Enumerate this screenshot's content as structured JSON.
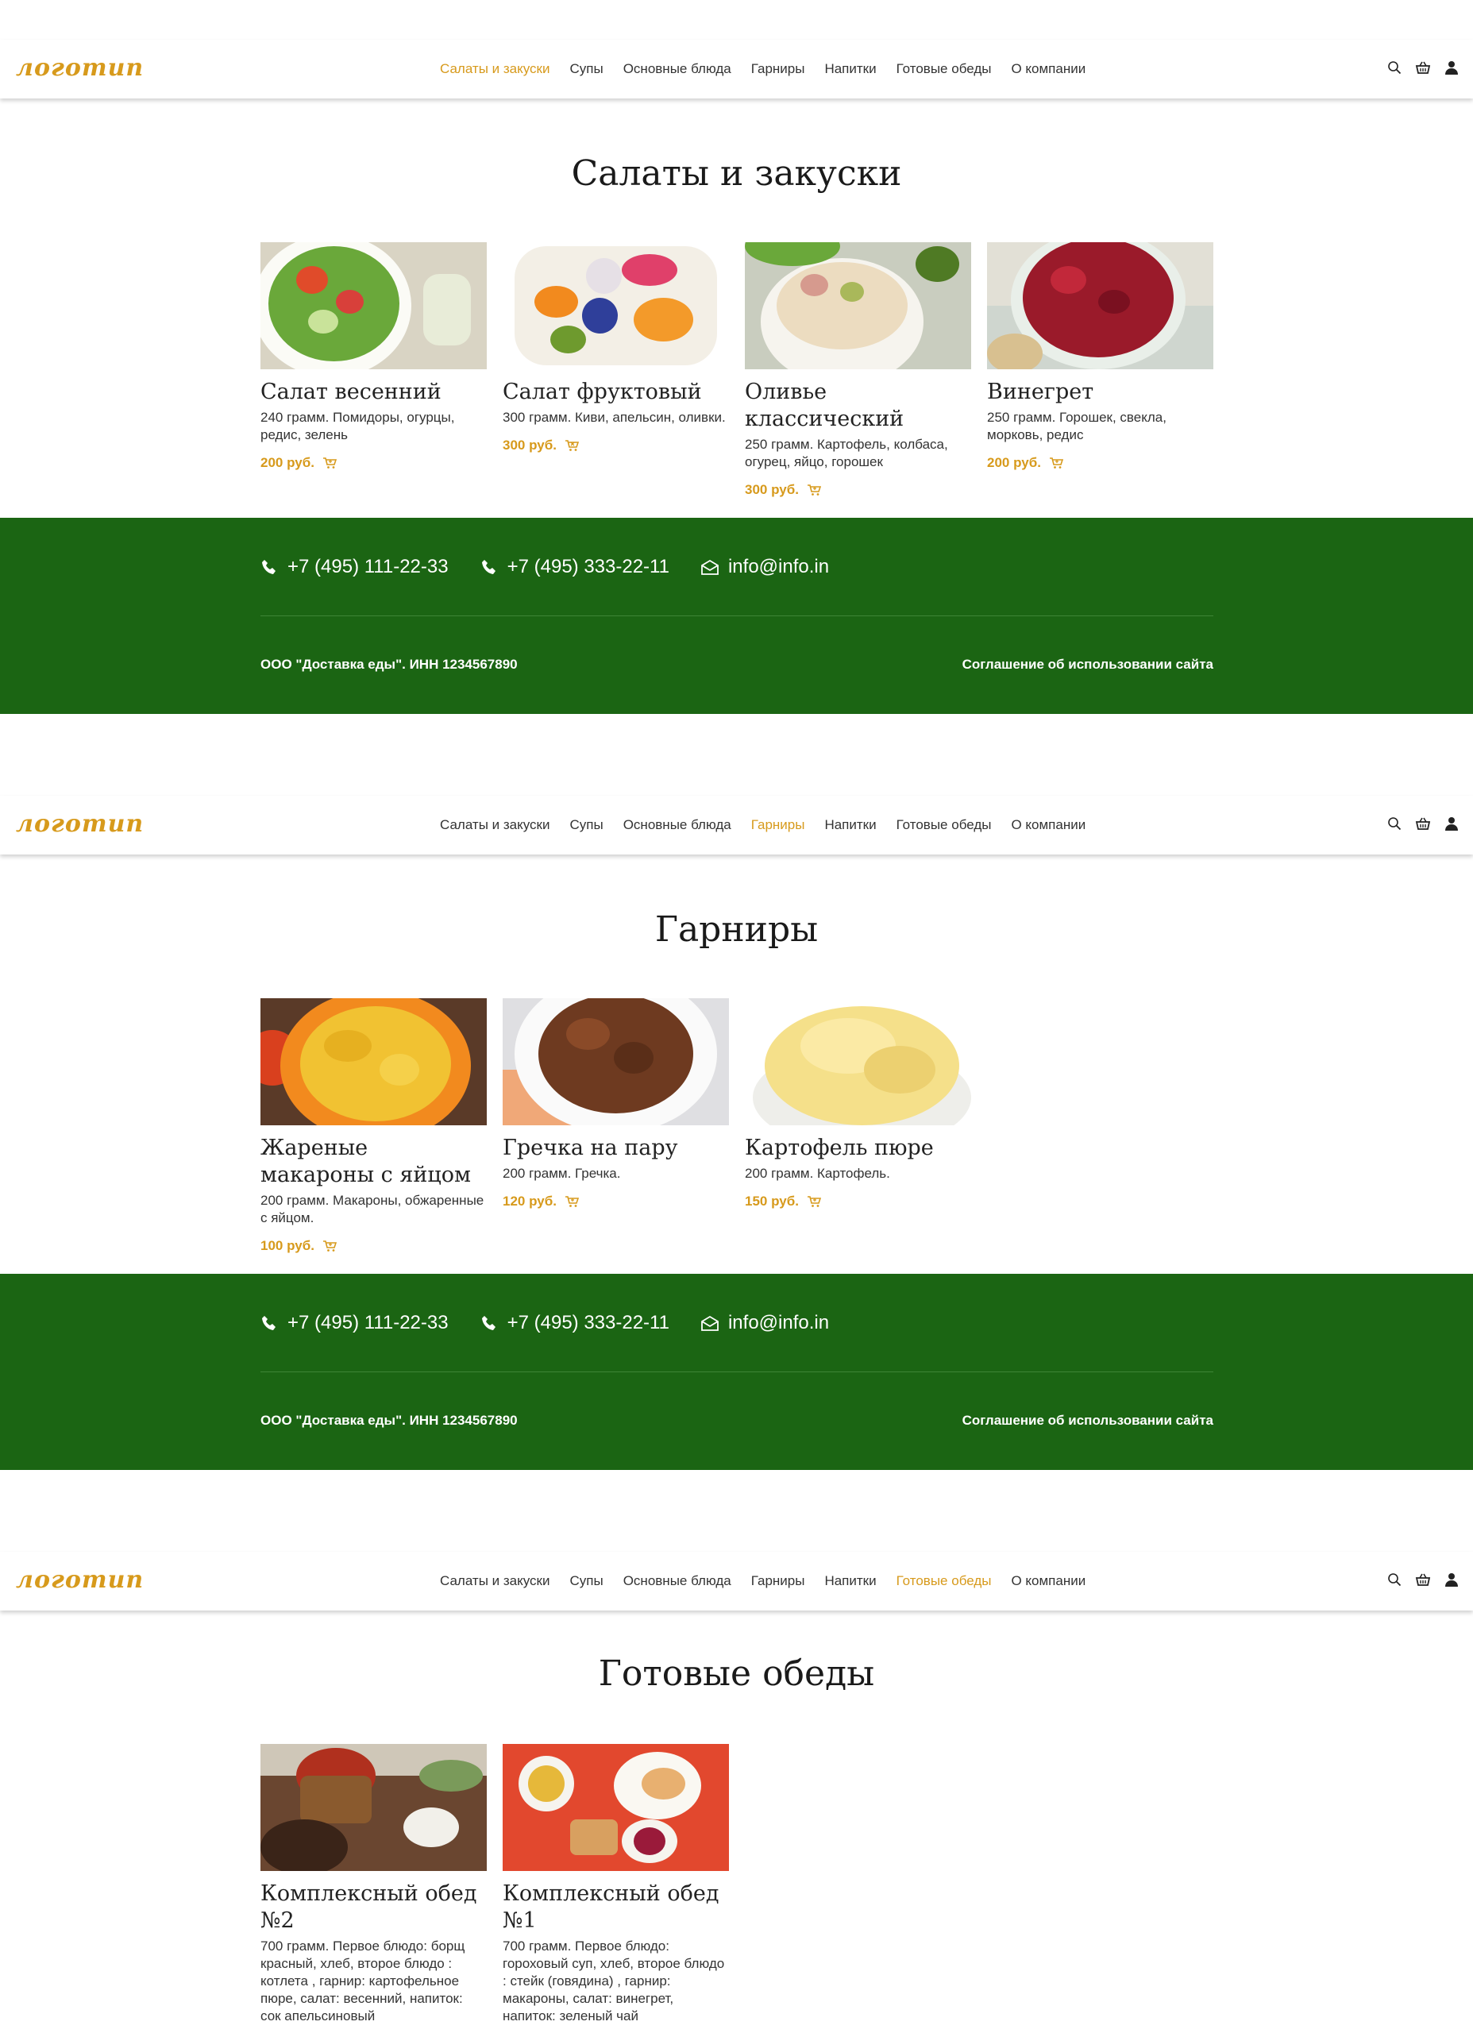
{
  "brand": {
    "logo_text": "логотип",
    "accent": "#d79a1c",
    "footer_bg": "#1b6513"
  },
  "nav": [
    "Салаты и закуски",
    "Супы",
    "Основные блюда",
    "Гарниры",
    "Напитки",
    "Готовые обеды",
    "О компании"
  ],
  "header_icons": [
    "search-icon",
    "basket-icon",
    "user-icon"
  ],
  "footer": {
    "phone1": "+7 (495) 111-22-33",
    "phone2": "+7 (495) 333-22-11",
    "email": "info@info.in",
    "company": "ООО \"Доставка еды\". ИНН 1234567890",
    "terms": "Соглашение об использовании сайта"
  },
  "pages": [
    {
      "title": "Салаты и закуски",
      "active_nav": 0,
      "cards": [
        {
          "name": "Салат весенний",
          "desc": "240 грамм. Помидоры, огурцы, редис, зелень",
          "price": "200 руб."
        },
        {
          "name": "Салат фруктовый",
          "desc": "300 грамм. Киви, апельсин, оливки.",
          "price": "300 руб."
        },
        {
          "name": "Оливье классический",
          "desc": "250 грамм. Картофель, колбаса, огурец, яйцо, горошек",
          "price": "300 руб."
        },
        {
          "name": "Винегрет",
          "desc": "250 грамм. Горошек, свекла, морковь, редис",
          "price": "200 руб."
        }
      ]
    },
    {
      "title": "Гарниры",
      "active_nav": 3,
      "cards": [
        {
          "name": "Жареные макароны с яйцом",
          "desc": "200 грамм. Макароны, обжаренные с яйцом.",
          "price": "100 руб."
        },
        {
          "name": "Гречка на пару",
          "desc": "200 грамм. Гречка.",
          "price": "120 руб."
        },
        {
          "name": "Картофель пюре",
          "desc": "200 грамм. Картофель.",
          "price": "150 руб."
        }
      ]
    },
    {
      "title": "Готовые обеды",
      "active_nav": 5,
      "cards": [
        {
          "name": "Комплексный обед №2",
          "desc": "700 грамм. Первое блюдо: борщ красный, хлеб, второе блюдо : котлета , гарнир: картофельное пюре, салат: весенний, напиток: сок апельсиновый",
          "price": ""
        },
        {
          "name": "Комплексный обед №1",
          "desc": "700 грамм. Первое блюдо: гороховый суп, хлеб, второе блюдо : стейк (говядина) , гарнир: макароны, салат: винегрет, напиток: зеленый чай",
          "price": ""
        }
      ]
    }
  ]
}
